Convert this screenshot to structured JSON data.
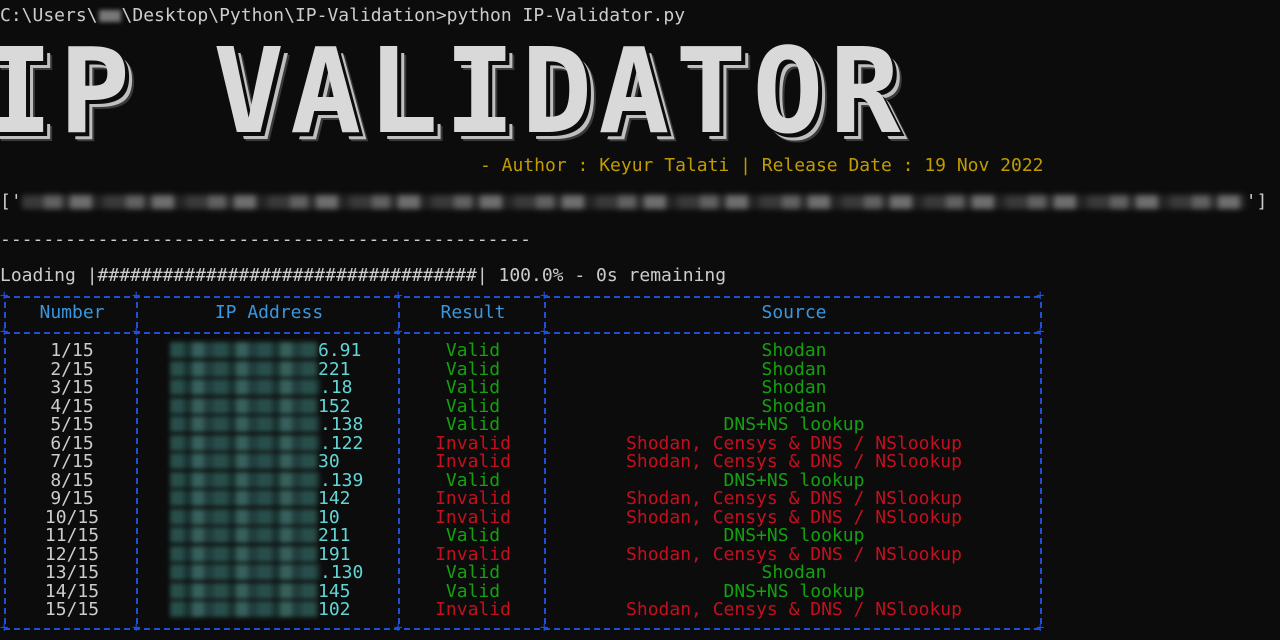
{
  "terminal": {
    "prompt_prefix": "C:\\Users\\",
    "prompt_suffix": "\\Desktop\\Python\\IP-Validation>python IP-Validator.py",
    "banner": "IP VALIDATOR",
    "author_line": "- Author : Keyur Talati | Release Date : 19 Nov 2022",
    "list_open": "['",
    "list_close": "']",
    "dashes": "-------------------------------------------------",
    "loading": "Loading |###################################| 100.0% - 0s remaining"
  },
  "table": {
    "headers": [
      "Number",
      "IP Address",
      "Result",
      "Source"
    ],
    "rows": [
      {
        "number": "1/15",
        "ip": "6.91",
        "result": "Valid",
        "source": "Shodan"
      },
      {
        "number": "2/15",
        "ip": "221",
        "result": "Valid",
        "source": "Shodan"
      },
      {
        "number": "3/15",
        "ip": ".18",
        "result": "Valid",
        "source": "Shodan"
      },
      {
        "number": "4/15",
        "ip": "152",
        "result": "Valid",
        "source": "Shodan"
      },
      {
        "number": "5/15",
        "ip": ".138",
        "result": "Valid",
        "source": "DNS+NS lookup"
      },
      {
        "number": "6/15",
        "ip": ".122",
        "result": "Invalid",
        "source": "Shodan, Censys & DNS / NSlookup"
      },
      {
        "number": "7/15",
        "ip": "30",
        "result": "Invalid",
        "source": "Shodan, Censys & DNS / NSlookup"
      },
      {
        "number": "8/15",
        "ip": ".139",
        "result": "Valid",
        "source": "DNS+NS lookup"
      },
      {
        "number": "9/15",
        "ip": "142",
        "result": "Invalid",
        "source": "Shodan, Censys & DNS / NSlookup"
      },
      {
        "number": "10/15",
        "ip": "10",
        "result": "Invalid",
        "source": "Shodan, Censys & DNS / NSlookup"
      },
      {
        "number": "11/15",
        "ip": "211",
        "result": "Valid",
        "source": "DNS+NS lookup"
      },
      {
        "number": "12/15",
        "ip": "191",
        "result": "Invalid",
        "source": "Shodan, Censys & DNS / NSlookup"
      },
      {
        "number": "13/15",
        "ip": ".130",
        "result": "Valid",
        "source": "Shodan"
      },
      {
        "number": "14/15",
        "ip": "145",
        "result": "Valid",
        "source": "DNS+NS lookup"
      },
      {
        "number": "15/15",
        "ip": "102",
        "result": "Invalid",
        "source": "Shodan, Censys & DNS / NSlookup"
      }
    ]
  },
  "colors": {
    "background": "#0c0c0c",
    "author": "#c19c00",
    "border": "#1f4fd8",
    "header": "#3a96dd",
    "ip": "#61d6d6",
    "valid": "#13a10e",
    "invalid": "#c50f1f"
  }
}
